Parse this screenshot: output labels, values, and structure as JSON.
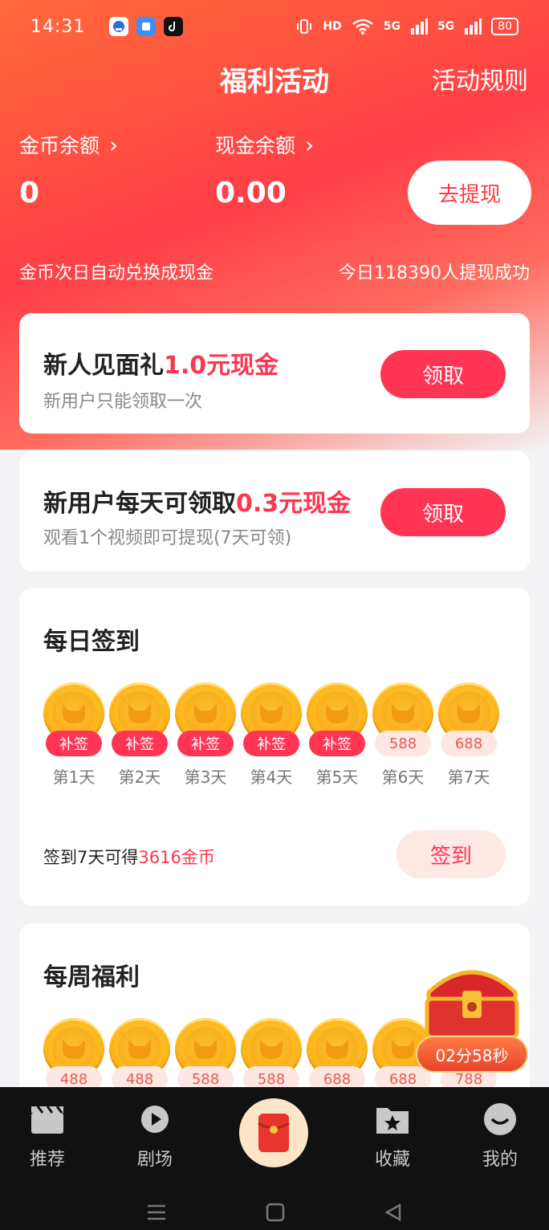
{
  "status_bar": {
    "time": "14:31",
    "battery": "80",
    "network": "5G",
    "hd": "HD"
  },
  "header": {
    "title": "福利活动",
    "rules_link": "活动规则"
  },
  "balances": {
    "coin_label": "金币余额",
    "coin_value": "0",
    "cash_label": "现金余额",
    "cash_value": "0.00",
    "withdraw_button": "去提现",
    "note_left": "金币次日自动兑换成现金",
    "note_right": "今日118390人提现成功"
  },
  "newbie_gift": {
    "title_prefix": "新人见面礼",
    "title_highlight": "1.0元现金",
    "subtitle": "新用户只能领取一次",
    "button": "领取"
  },
  "daily_cash": {
    "title_prefix": "新用户每天可领取",
    "title_highlight": "0.3元现金",
    "subtitle": "观看1个视频即可提现(7天可领)",
    "button": "领取"
  },
  "daily_signin": {
    "title": "每日签到",
    "days": [
      {
        "badge": "补签",
        "day": "第1天",
        "style": "red"
      },
      {
        "badge": "补签",
        "day": "第2天",
        "style": "red"
      },
      {
        "badge": "补签",
        "day": "第3天",
        "style": "red"
      },
      {
        "badge": "补签",
        "day": "第4天",
        "style": "red"
      },
      {
        "badge": "补签",
        "day": "第5天",
        "style": "red"
      },
      {
        "badge": "588",
        "day": "第6天",
        "style": "light"
      },
      {
        "badge": "688",
        "day": "第7天",
        "style": "light"
      }
    ],
    "summary_prefix": "签到7天可得",
    "summary_highlight": "3616金币",
    "button": "签到"
  },
  "weekly_welfare": {
    "title": "每周福利",
    "coins": [
      "488",
      "488",
      "588",
      "588",
      "688",
      "688",
      "788"
    ]
  },
  "floating_chest": {
    "timer": "02分58秒"
  },
  "tabbar": {
    "tabs": [
      {
        "label": "推荐",
        "icon": "clapperboard-icon"
      },
      {
        "label": "剧场",
        "icon": "play-icon"
      },
      {
        "label": "",
        "icon": "red-envelope-icon"
      },
      {
        "label": "收藏",
        "icon": "star-folder-icon"
      },
      {
        "label": "我的",
        "icon": "smile-icon"
      }
    ]
  },
  "colors": {
    "accent": "#ff3553",
    "hero_start": "#ff6a3a",
    "hero_end": "#ff3f47",
    "coin": "#ffb81f"
  }
}
